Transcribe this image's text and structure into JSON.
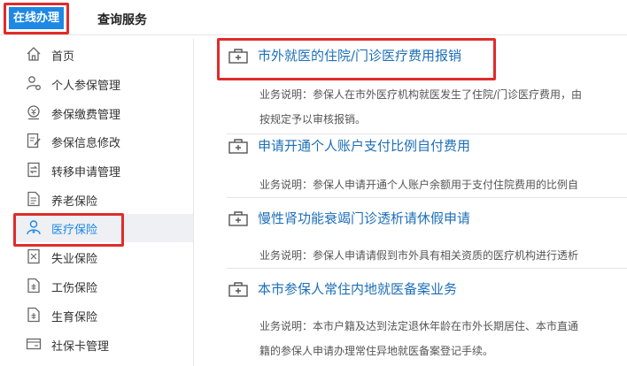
{
  "top_tabs": {
    "active_label": "在线办理",
    "other_label": "查询服务"
  },
  "sidebar": {
    "items": [
      {
        "label": "首页",
        "icon": "home-icon"
      },
      {
        "label": "个人参保管理",
        "icon": "person-gear-icon"
      },
      {
        "label": "参保缴费管理",
        "icon": "payment-icon"
      },
      {
        "label": "参保信息修改",
        "icon": "edit-document-icon"
      },
      {
        "label": "转移申请管理",
        "icon": "transfer-icon"
      },
      {
        "label": "养老保险",
        "icon": "document-icon"
      },
      {
        "label": "医疗保险",
        "icon": "medical-person-icon",
        "active": true
      },
      {
        "label": "失业保险",
        "icon": "unemployment-icon"
      },
      {
        "label": "工伤保险",
        "icon": "injury-icon"
      },
      {
        "label": "生育保险",
        "icon": "maternity-icon"
      },
      {
        "label": "社保卡管理",
        "icon": "card-icon"
      }
    ]
  },
  "services": [
    {
      "title": "市外就医的住院/门诊医疗费用报销",
      "desc_lines": [
        "业务说明：参保人在市外医疗机构就医发生了住院/门诊医疗费用，由",
        "按规定予以审核报销。"
      ]
    },
    {
      "title": "申请开通个人账户支付比例自付费用",
      "desc_lines": [
        "业务说明：参保人申请开通个人账户余额用于支付住院费用的比例自"
      ]
    },
    {
      "title": "慢性肾功能衰竭门诊透析请休假申请",
      "desc_lines": [
        "业务说明：参保人申请请假到市外具有相关资质的医疗机构进行透析"
      ]
    },
    {
      "title": "本市参保人常住内地就医备案业务",
      "desc_lines": [
        "业务说明：本市户籍及达到法定退休年龄在市外长期居住、本市直通",
        "籍的参保人申请办理常住异地就医备案登记手续。"
      ]
    }
  ],
  "colors": {
    "accent": "#1e88e5",
    "highlight": "#e02b2b",
    "link": "#1e6fb8"
  }
}
